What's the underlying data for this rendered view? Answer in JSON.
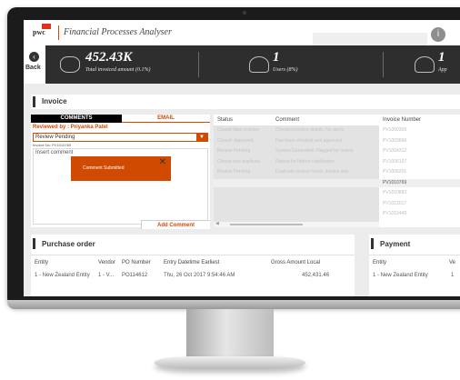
{
  "app": {
    "brand": "pwc",
    "title": "Financial Processes Analyser",
    "info_icon": "i"
  },
  "kpi": {
    "back_label": "Back",
    "items": [
      {
        "icon": "piggy-bank-icon",
        "value": "452.43K",
        "label": "Total invoiced amount (0.1%)"
      },
      {
        "icon": "users-icon",
        "value": "1",
        "label": "Users (8%)"
      },
      {
        "icon": "approvers-icon",
        "value": "1",
        "label": "App"
      }
    ]
  },
  "invoice": {
    "section_title": "Invoice",
    "tabs": {
      "comments": "COMMENTS",
      "email": "EMAIL"
    },
    "reviewed_by": "Reviewed by : Priyanka Patel",
    "status_value": "Review Pending",
    "invoice_no": "Invoice No: PV1010769",
    "comment_placeholder": "Insert comment",
    "toast": {
      "message": "Comment Submitted",
      "close": "✕"
    },
    "add_comment": "Add Comment",
    "table": {
      "headers": [
        "Status",
        "Comment",
        "Invoice Number"
      ],
      "rows": [
        [
          "Closed-false positive",
          "Checked invoice details. No alerts",
          "PV1000305"
        ],
        [
          "Closed: Approved",
          "Has been checked and approved",
          "PV1003666"
        ],
        [
          "Review Pending",
          "System Generated: Flagged for review",
          "PV1004312"
        ],
        [
          "Closed-true duplicate",
          "Raised for further clarification",
          "PV1006107"
        ],
        [
          "Review Pending",
          "Duplicate invoice found. Invoice was",
          "PV1006201"
        ],
        [
          "",
          "",
          "PV1010769"
        ],
        [
          "",
          "",
          "PV1010883"
        ],
        [
          "",
          "",
          "PV1012017"
        ],
        [
          "",
          "",
          "PV1012449"
        ]
      ],
      "selected_row": 5
    }
  },
  "purchase_order": {
    "section_title": "Purchase order",
    "headers": [
      "Entity",
      "Vendor",
      "PO Number",
      "Entry Datetime Earliest",
      "Gross Amount Local"
    ],
    "row": [
      "1 - New Zealand Entity",
      "1 - V...",
      "PO114612",
      "Thu, 26 Oct 2017 9:54:46 AM",
      "452,431.46"
    ]
  },
  "payment": {
    "section_title": "Payment",
    "headers": [
      "Entity",
      "Ve"
    ],
    "row": [
      "1 - New Zealand Entity",
      "1"
    ]
  }
}
